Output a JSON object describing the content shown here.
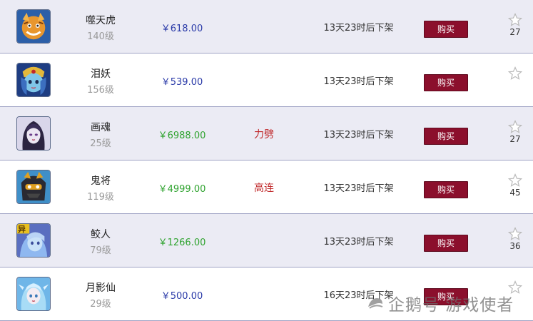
{
  "listings": [
    {
      "name": "噬天虎",
      "level": "140级",
      "price": "￥618.00",
      "price_color": "blue",
      "tag": "",
      "timer": "13天23时后下架",
      "buy_label": "购买",
      "favorites": "27",
      "icon": "tiger-avatar-icon",
      "shade": true
    },
    {
      "name": "泪妖",
      "level": "156级",
      "price": "￥539.00",
      "price_color": "blue",
      "tag": "",
      "timer": "13天23时后下架",
      "buy_label": "购买",
      "favorites": "",
      "icon": "tear-demon-avatar-icon",
      "shade": false
    },
    {
      "name": "画魂",
      "level": "25级",
      "price": "￥6988.00",
      "price_color": "green",
      "tag": "力劈",
      "timer": "13天23时后下架",
      "buy_label": "购买",
      "favorites": "27",
      "icon": "painted-soul-avatar-icon",
      "shade": true
    },
    {
      "name": "鬼将",
      "level": "119级",
      "price": "￥4999.00",
      "price_color": "green",
      "tag": "高连",
      "timer": "13天23时后下架",
      "buy_label": "购买",
      "favorites": "45",
      "icon": "ghost-general-avatar-icon",
      "shade": false
    },
    {
      "name": "鲛人",
      "level": "79级",
      "price": "￥1266.00",
      "price_color": "green",
      "tag": "",
      "timer": "13天23时后下架",
      "buy_label": "购买",
      "favorites": "36",
      "icon": "mermaid-avatar-icon",
      "shade": true,
      "badge": "异"
    },
    {
      "name": "月影仙",
      "level": "29级",
      "price": "￥500.00",
      "price_color": "blue",
      "tag": "",
      "timer": "16天23时后下架",
      "buy_label": "购买",
      "favorites": "",
      "icon": "moon-fairy-avatar-icon",
      "shade": false
    }
  ],
  "watermark": "企鹅号 游戏使者",
  "colors": {
    "price_blue": "#2a3aa8",
    "price_green": "#2fa32f",
    "tag_red": "#c0282a",
    "buy_button": "#8b0f2c",
    "row_shade": "#ebebf4",
    "divider": "#9fa3c4"
  }
}
